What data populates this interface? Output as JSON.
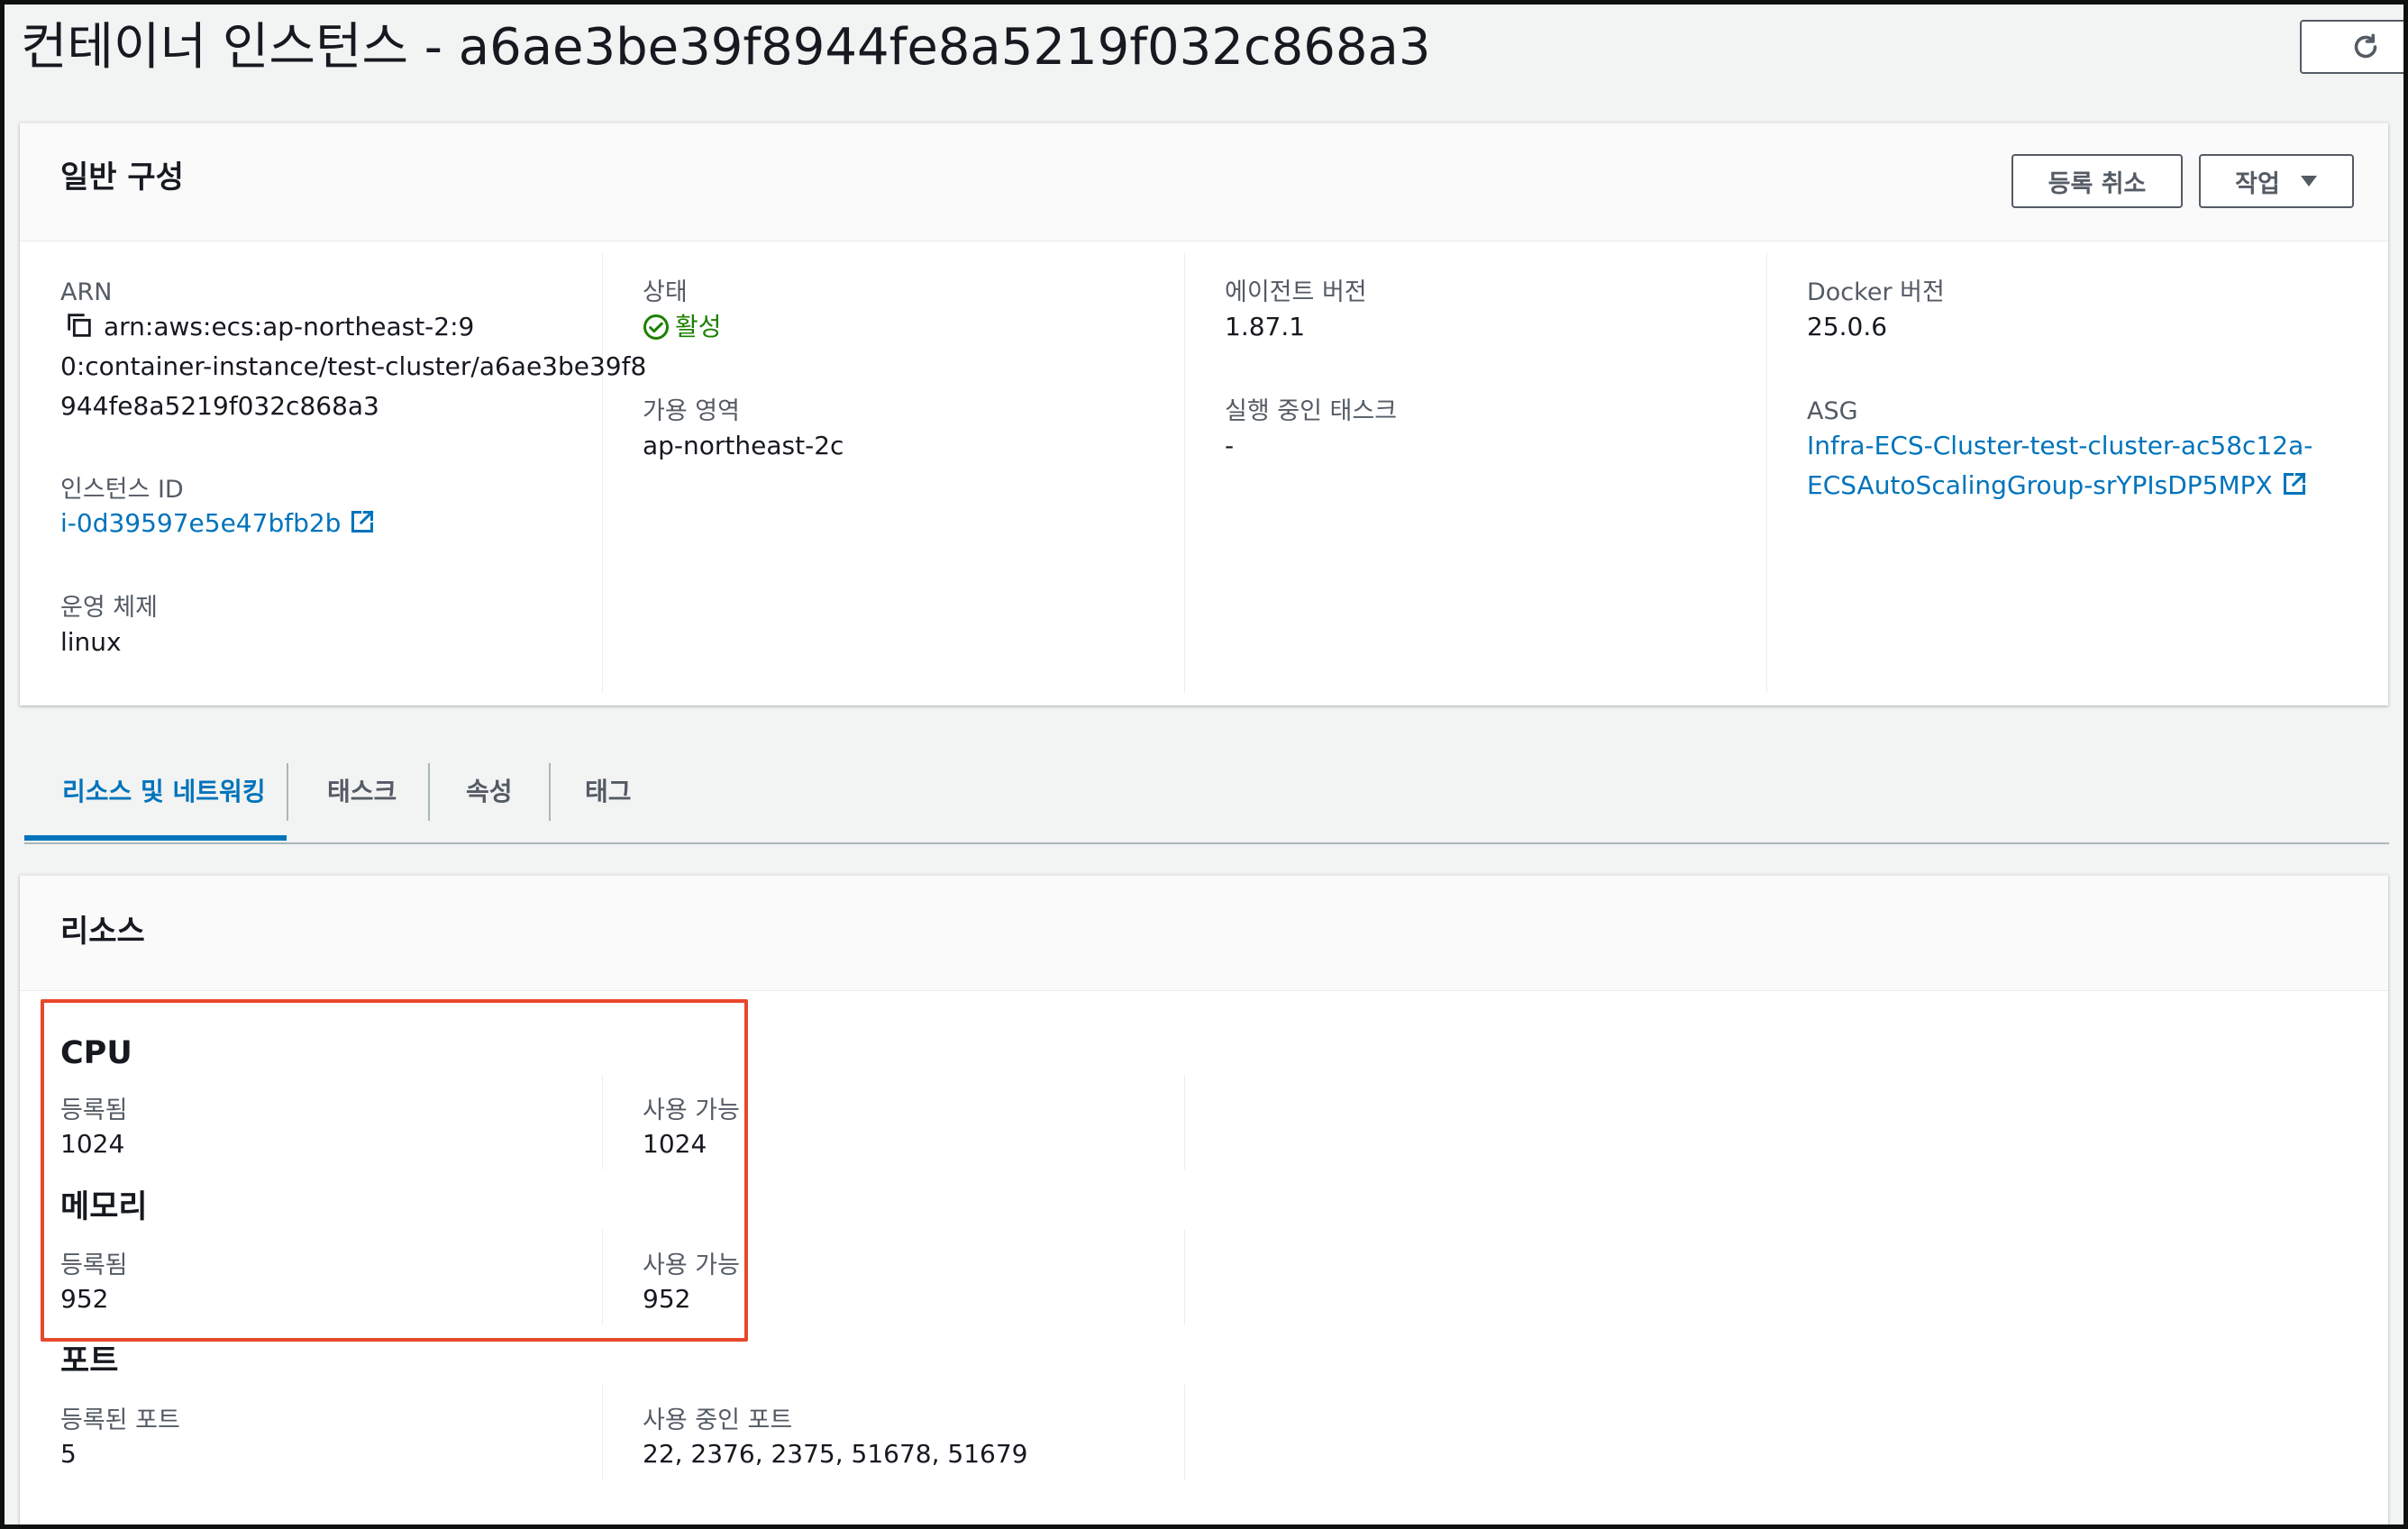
{
  "page": {
    "title": "컨테이너 인스턴스 - a6ae3be39f8944fe8a5219f032c868a3",
    "refresh_icon": "refresh-icon"
  },
  "general": {
    "title": "일반 구성",
    "deregister_label": "등록 취소",
    "actions_label": "작업",
    "arn_label": "ARN",
    "arn_lines": [
      "arn:aws:ecs:ap-northeast-2:9",
      "0:container-instance/test-cluster/a6ae3be39f8",
      "944fe8a5219f032c868a3"
    ],
    "instance_id_label": "인스턴스 ID",
    "instance_id": "i-0d39597e5e47bfb2b",
    "os_label": "운영 체제",
    "os": "linux",
    "status_label": "상태",
    "status": "활성",
    "az_label": "가용 영역",
    "az": "ap-northeast-2c",
    "agent_label": "에이전트 버전",
    "agent": "1.87.1",
    "running_tasks_label": "실행 중인 태스크",
    "running_tasks": "-",
    "docker_label": "Docker 버전",
    "docker": "25.0.6",
    "asg_label": "ASG",
    "asg_lines": [
      "Infra-ECS-Cluster-test-cluster-ac58c12a-",
      "ECSAutoScalingGroup-srYPIsDP5MPX"
    ],
    "colors": {
      "link": "#0073bb",
      "success": "#1d8102",
      "highlight": "#e8472b"
    }
  },
  "tabs": [
    {
      "label": "리소스 및 네트워킹",
      "active": true
    },
    {
      "label": "태스크",
      "active": false
    },
    {
      "label": "속성",
      "active": false
    },
    {
      "label": "태그",
      "active": false
    }
  ],
  "resources": {
    "title": "리소스",
    "cpu": {
      "title": "CPU",
      "registered_label": "등록됨",
      "registered": "1024",
      "available_label": "사용 가능",
      "available": "1024"
    },
    "memory": {
      "title": "메모리",
      "registered_label": "등록됨",
      "registered": "952",
      "available_label": "사용 가능",
      "available": "952"
    },
    "ports": {
      "title": "포트",
      "registered_label": "등록된 포트",
      "registered": "5",
      "in_use_label": "사용 중인 포트",
      "in_use": "22, 2376, 2375, 51678, 51679"
    }
  }
}
